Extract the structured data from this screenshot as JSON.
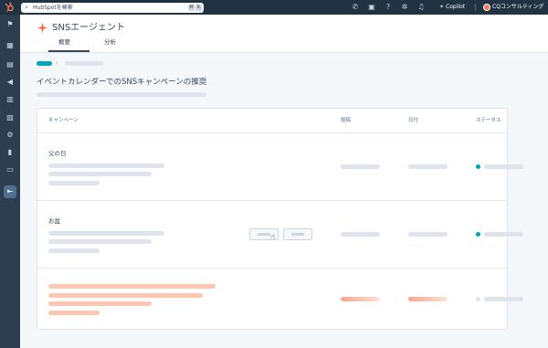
{
  "topbar": {
    "search_placeholder": "HubSpotを検索",
    "search_shortcut_1": "⌘",
    "search_shortcut_2": "K",
    "copilot_label": "Copilot",
    "account_label": "CQコンサルティング ▾",
    "icons": [
      "phone-icon",
      "marketplace-icon",
      "help-icon",
      "settings-icon",
      "notifications-icon"
    ]
  },
  "sidebar": {
    "items": [
      "bookmark-icon",
      "grid-icon",
      "contacts-icon",
      "megaphone-icon",
      "table-icon",
      "commerce-icon",
      "automation-icon",
      "reports-icon",
      "folder-icon",
      "collapse-icon"
    ]
  },
  "header": {
    "title": "SNSエージェント",
    "tabs": [
      {
        "label": "概要",
        "active": true
      },
      {
        "label": "分析",
        "active": false
      }
    ]
  },
  "page": {
    "title": "イベントカレンダーでのSNSキャンペーンの推奨"
  },
  "table": {
    "columns": [
      "キャンペーン",
      "投稿",
      "日付",
      "ステータス"
    ],
    "rows": [
      {
        "title": "父の日",
        "status_color": "#00a4bd"
      },
      {
        "title": "お盆",
        "status_color": "#00a4bd"
      },
      {
        "title": "",
        "status_color": "#dfe3eb"
      }
    ]
  },
  "colors": {
    "brand": "#ff7a59",
    "accent": "#00a4bd",
    "nav_dark": "#213343"
  }
}
